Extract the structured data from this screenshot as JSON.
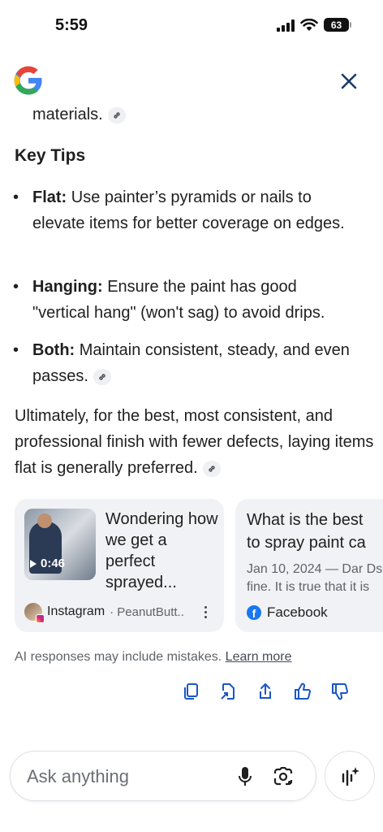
{
  "status": {
    "time": "5:59",
    "battery": "63"
  },
  "colors": {
    "link_gray": "#5f6368",
    "card_bg": "#f0f2f5",
    "facebook": "#1877f2"
  },
  "answer": {
    "fragment": "materials.",
    "heading": "Key Tips",
    "tips": [
      {
        "label": "Flat:",
        "text": " Use painter’s pyramids or nails to elevate items for better coverage on edges."
      },
      {
        "label": "Hanging:",
        "text": " Ensure the paint has good \"vertical hang\" (won't sag) to avoid drips."
      },
      {
        "label": "Both:",
        "text": " Maintain consistent, steady, and even passes."
      }
    ],
    "conclusion": "Ultimately, for the best, most consistent, and professional finish with fewer defects, laying items flat is generally preferred."
  },
  "cards": [
    {
      "duration": "0:46",
      "title": "Wondering how we get a perfect sprayed...",
      "source": "Instagram",
      "source_sub": "· PeanutButt..",
      "icon": "instagram-icon"
    },
    {
      "title": "What is the best to spray paint ca",
      "snippet_line1": "Jan 10, 2024 — Dar Ds",
      "snippet_line2": "fine. It is true that it is",
      "source": "Facebook",
      "icon": "facebook-icon"
    }
  ],
  "disclaimer": {
    "text": "AI responses may include mistakes.",
    "link": "Learn more"
  },
  "ask": {
    "placeholder": "Ask anything"
  }
}
